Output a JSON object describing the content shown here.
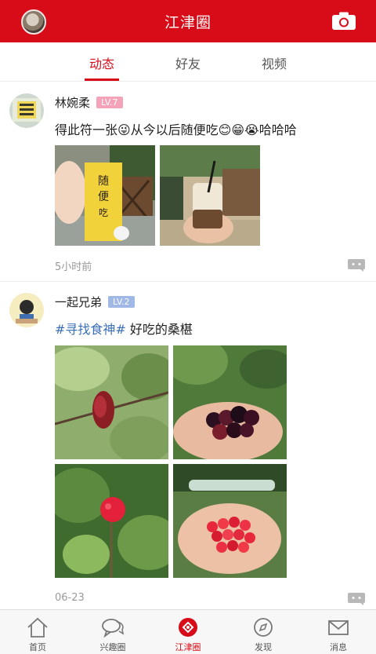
{
  "header": {
    "title": "江津圈",
    "avatar_icon": "user-avatar",
    "camera_icon": "camera-icon",
    "accent": "#d80c18"
  },
  "tabs": [
    {
      "label": "动态",
      "active": true
    },
    {
      "label": "好友",
      "active": false
    },
    {
      "label": "视频",
      "active": false
    }
  ],
  "posts": [
    {
      "username": "林婉柔",
      "level": "LV.7",
      "level_color": "#f4a3b8",
      "text": "得此符一张😜从今以后随便吃😊😁😭哈哈哈",
      "time": "5小时前"
    },
    {
      "username": "一起兄弟",
      "level": "LV.2",
      "level_color": "#9fb8e6",
      "hashtag": "#寻找食神#",
      "text": " 好吃的桑椹",
      "time": "06-23"
    }
  ],
  "bottom_nav": [
    {
      "label": "首页",
      "icon": "home-icon",
      "active": false
    },
    {
      "label": "兴趣圈",
      "icon": "chat-bubbles-icon",
      "active": false
    },
    {
      "label": "江津圈",
      "icon": "jiangjin-circle-icon",
      "active": true
    },
    {
      "label": "发现",
      "icon": "compass-icon",
      "active": false
    },
    {
      "label": "消息",
      "icon": "mail-icon",
      "active": false
    }
  ]
}
